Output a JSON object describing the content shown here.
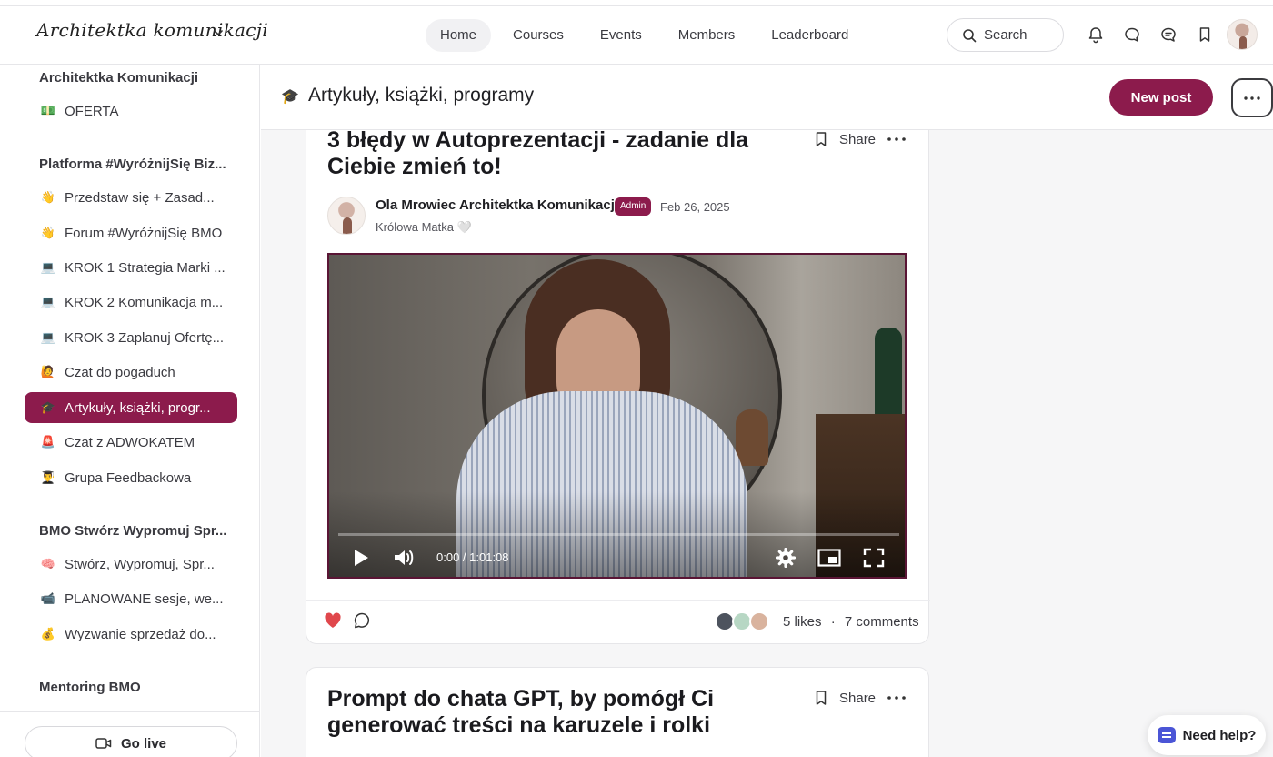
{
  "header": {
    "logo_text": "Architektka komunikacji",
    "nav": [
      "Home",
      "Courses",
      "Events",
      "Members",
      "Leaderboard"
    ],
    "active_nav": "Home",
    "search_label": "Search"
  },
  "sidebar": {
    "sections": [
      {
        "title": "Architektka Komunikacji",
        "items": [
          {
            "emoji": "💵",
            "label": "OFERTA"
          }
        ]
      },
      {
        "title": "Platforma #WyróżnijSię Biz...",
        "items": [
          {
            "emoji": "👋",
            "label": "Przedstaw się + Zasad..."
          },
          {
            "emoji": "👋",
            "label": "Forum #WyróżnijSię BMO"
          },
          {
            "emoji": "💻",
            "label": "KROK 1 Strategia Marki ..."
          },
          {
            "emoji": "💻",
            "label": "KROK 2 Komunikacja m..."
          },
          {
            "emoji": "💻",
            "label": "KROK 3 Zaplanuj Ofertę..."
          },
          {
            "emoji": "🙋",
            "label": "Czat do pogaduch"
          },
          {
            "emoji": "🎓",
            "label": "Artykuły, książki, progr...",
            "active": true
          },
          {
            "emoji": "🚨",
            "label": "Czat z ADWOKATEM"
          },
          {
            "emoji": "👨‍🎓",
            "label": "Grupa Feedbackowa"
          }
        ]
      },
      {
        "title": "BMO Stwórz Wypromuj Spr...",
        "items": [
          {
            "emoji": "🧠",
            "label": "Stwórz, Wypromuj, Spr..."
          },
          {
            "emoji": "📹",
            "label": "PLANOWANE sesje, we..."
          },
          {
            "emoji": "💰",
            "label": "Wyzwanie sprzedaż do..."
          }
        ]
      },
      {
        "title": "Mentoring BMO",
        "items": []
      }
    ],
    "go_live_label": "Go live"
  },
  "space": {
    "icon": "🎓",
    "title": "Artykuły, książki, programy",
    "new_post_label": "New post"
  },
  "posts": [
    {
      "title": "3 błędy w Autoprezentacji - zadanie dla Ciebie zmień to!",
      "share_label": "Share",
      "author": "Ola Mrowiec Architektka Komunikacji",
      "badge": "Admin",
      "date": "Feb 26, 2025",
      "author_subtitle": "Królowa Matka 🤍",
      "video_time": "0:00 / 1:01:08",
      "likes_text": "5 likes",
      "comments_text": "7 comments",
      "separator": "·"
    },
    {
      "title": "Prompt do chata GPT, by pomógł Ci generować treści na karuzele i rolki",
      "share_label": "Share"
    }
  ],
  "help": {
    "label": "Need help?"
  },
  "colors": {
    "accent": "#8c1b4c",
    "like": "#e0474c"
  }
}
